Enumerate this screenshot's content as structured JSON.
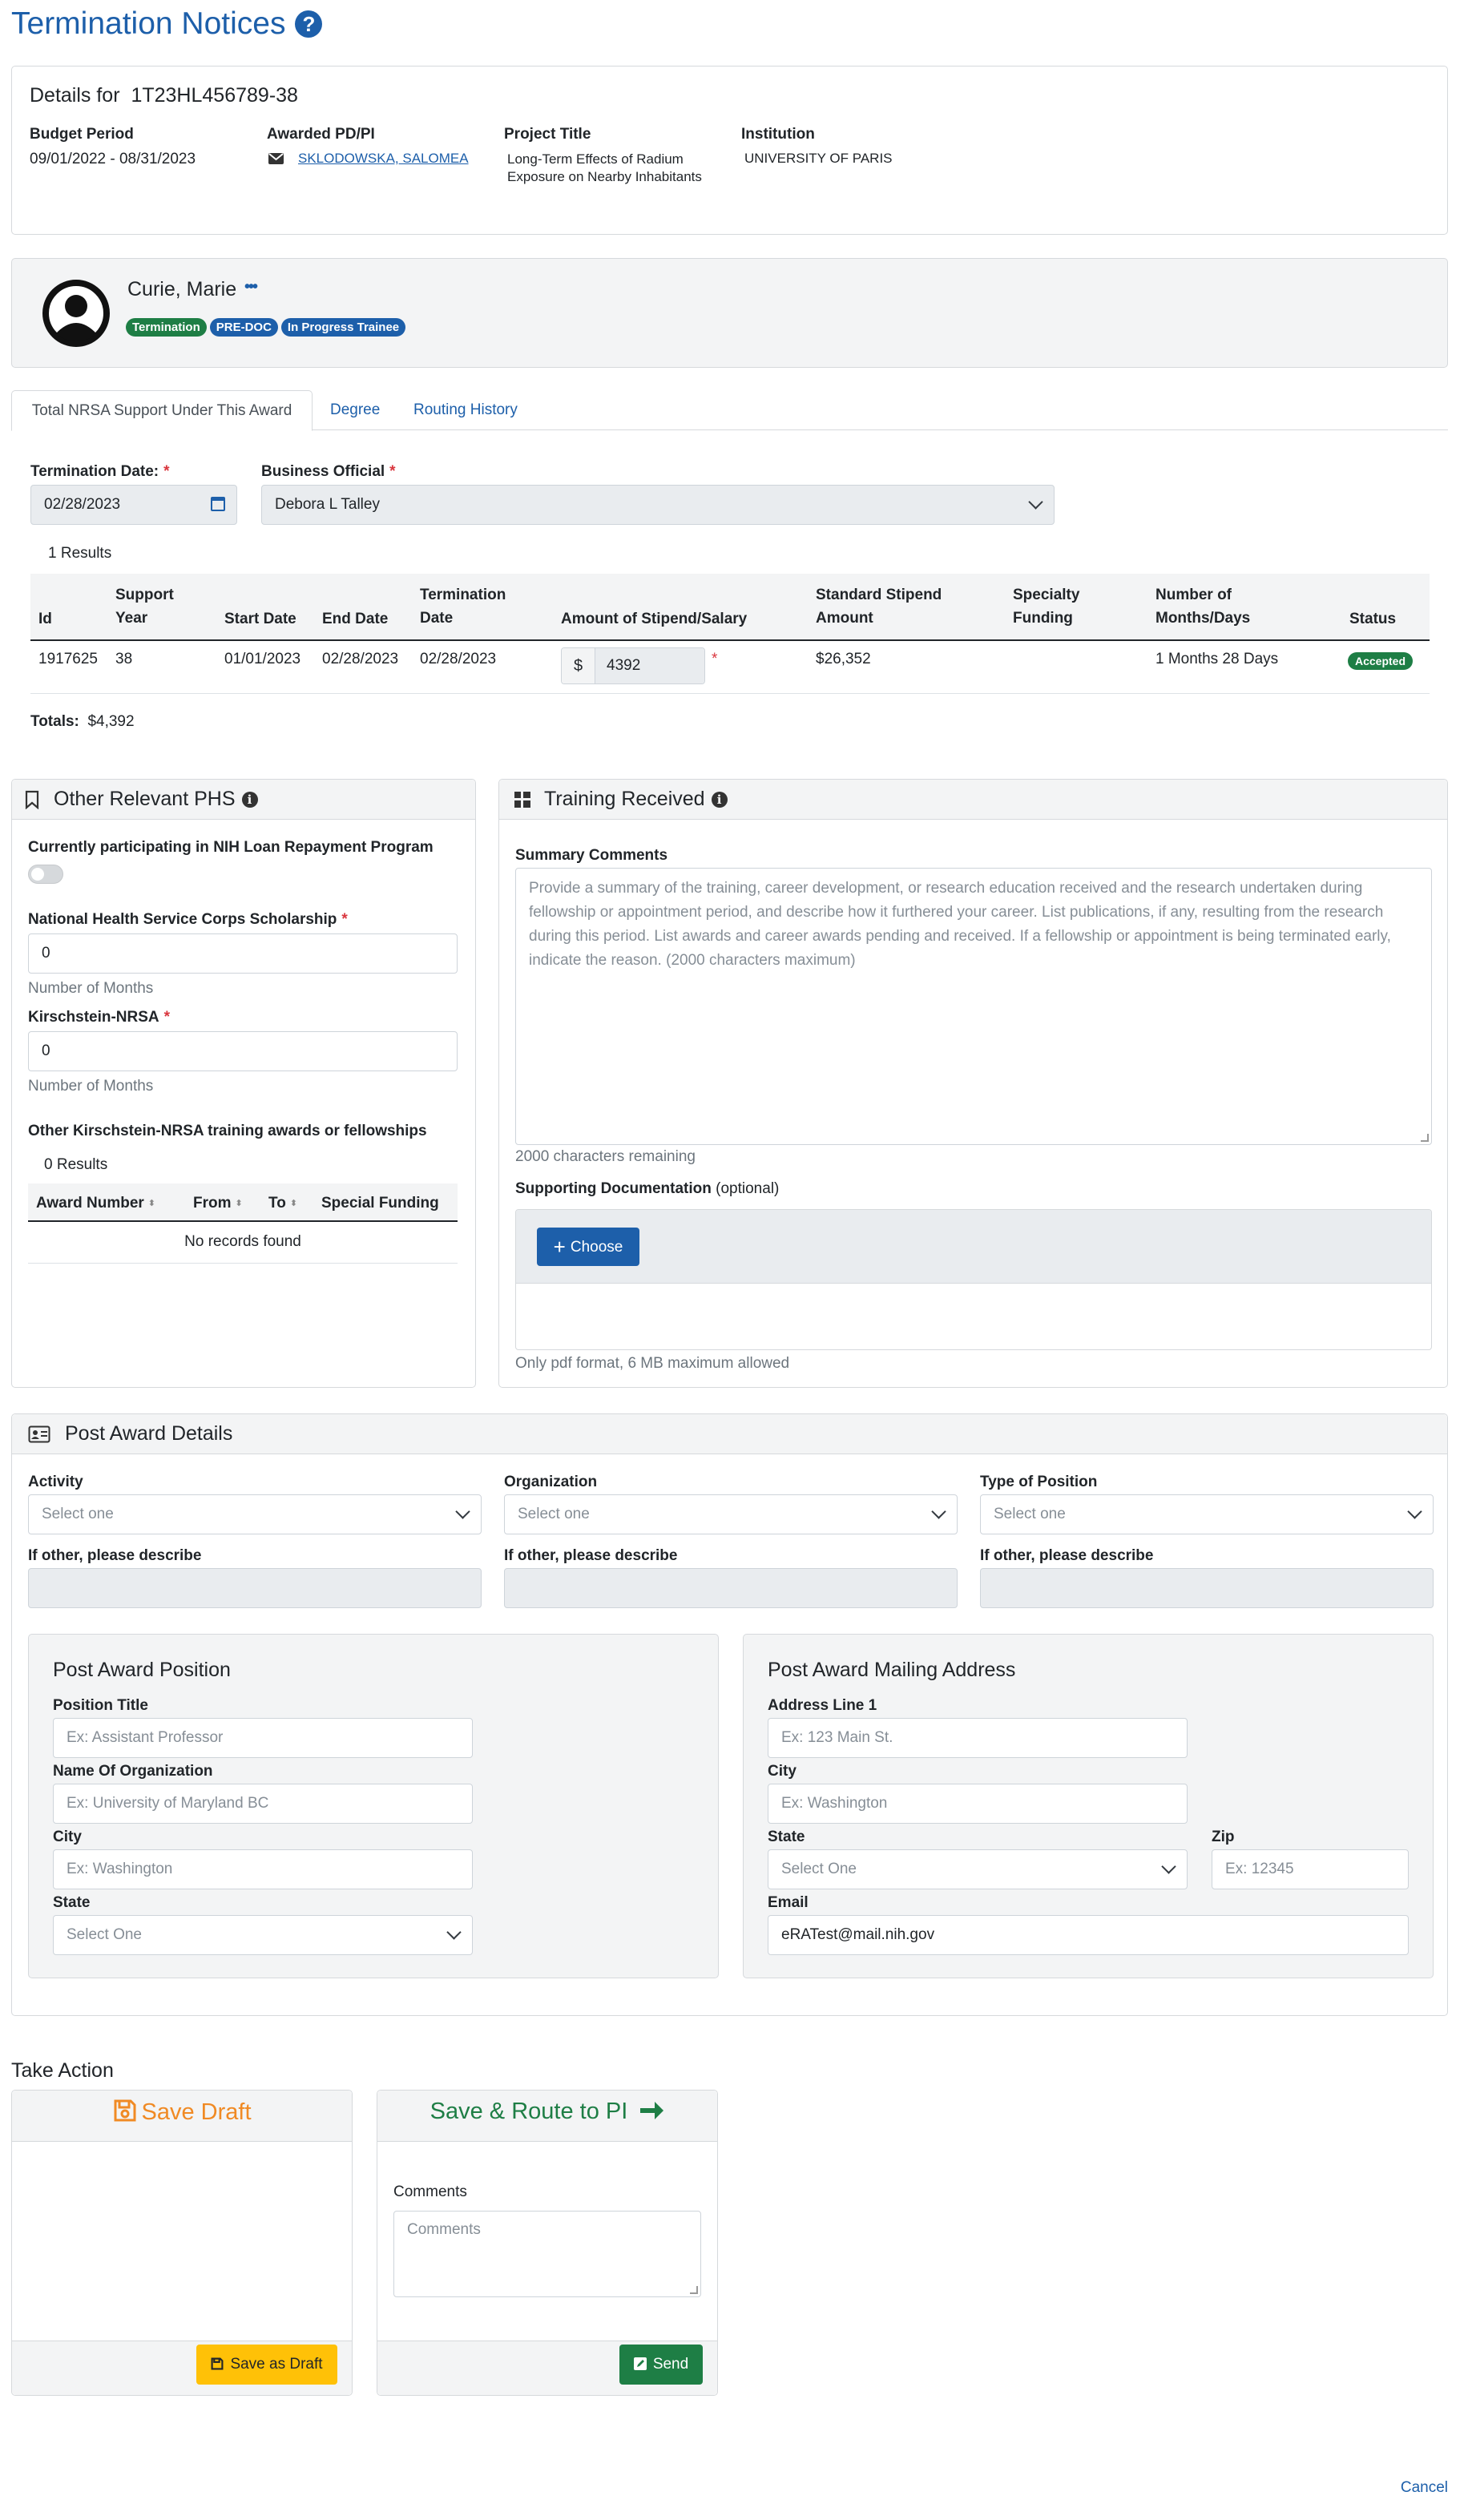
{
  "page": {
    "title": "Termination Notices"
  },
  "details": {
    "label": "Details for",
    "grant_number": "1T23HL456789-38",
    "budget_period_label": "Budget Period",
    "budget_period": "09/01/2022 - 08/31/2023",
    "pi_label": "Awarded PD/PI",
    "pi_name": "SKLODOWSKA, SALOMEA",
    "project_title_label": "Project Title",
    "project_title_line1": "Long-Term Effects of Radium",
    "project_title_line2": "Exposure on Nearby Inhabitants",
    "institution_label": "Institution",
    "institution": "UNIVERSITY OF PARIS"
  },
  "trainee": {
    "name": "Curie, Marie",
    "more": "•••",
    "badges": [
      "Termination",
      "PRE-DOC",
      "In Progress Trainee"
    ],
    "badge_colors": [
      "#1e7e45",
      "#1d5faa",
      "#1d5faa"
    ]
  },
  "tabs": [
    "Total NRSA Support Under This Award",
    "Degree",
    "Routing History"
  ],
  "termination": {
    "date_label": "Termination Date:",
    "date_value": "02/28/2023",
    "bo_label": "Business Official",
    "bo_value": "Debora L Talley",
    "results": "1 Results"
  },
  "support_table": {
    "headers": [
      "Id",
      "Support Year",
      "Start Date",
      "End Date",
      "Termination Date",
      "Amount of Stipend/Salary",
      "Standard Stipend Amount",
      "Specialty Funding",
      "Number of Months/Days",
      "Status"
    ],
    "row": {
      "id": "1917625",
      "year": "38",
      "start": "01/01/2023",
      "end": "02/28/2023",
      "term": "02/28/2023",
      "currency": "$",
      "amount": "4392",
      "standard": "$26,352",
      "specialty": "",
      "months": "1 Months 28 Days",
      "status": "Accepted"
    },
    "totals_label": "Totals:",
    "totals_value": "$4,392"
  },
  "phs": {
    "title": "Other Relevant PHS",
    "loan_label": "Currently participating in NIH Loan Repayment Program",
    "nhsc_label": "National Health Service Corps Scholarship",
    "nhsc_value": "0",
    "months_help": "Number of Months",
    "nrsa_label": "Kirschstein-NRSA",
    "nrsa_value": "0",
    "other_label": "Other Kirschstein-NRSA training awards or fellowships",
    "results": "0 Results",
    "headers": [
      "Award Number",
      "From",
      "To",
      "Special Funding"
    ],
    "empty": "No records found"
  },
  "training": {
    "title": "Training Received",
    "summary_label": "Summary Comments",
    "summary_placeholder": "Provide a summary of the training, career development, or research education received and the research undertaken during fellowship or appointment period, and describe how it furthered your career. List publications, if any, resulting from the research during this period. List awards and career awards pending and received. If a fellowship or appointment is being terminated early, indicate the reason. (2000 characters maximum)",
    "remaining": "2000 characters remaining",
    "doc_label": "Supporting Documentation",
    "doc_optional": "(optional)",
    "choose": "Choose",
    "doc_help": "Only pdf format, 6 MB maximum allowed"
  },
  "post_award": {
    "title": "Post Award Details",
    "activity_label": "Activity",
    "org_label": "Organization",
    "type_label": "Type of Position",
    "select_one": "Select one",
    "other_label": "If other, please describe",
    "position": {
      "title": "Post Award Position",
      "position_title_label": "Position Title",
      "position_title_ph": "Ex: Assistant Professor",
      "org_name_label": "Name Of Organization",
      "org_name_ph": "Ex: University of Maryland BC",
      "city_label": "City",
      "city_ph": "Ex: Washington",
      "state_label": "State",
      "state_value": "Select One"
    },
    "address": {
      "title": "Post Award Mailing Address",
      "line1_label": "Address Line 1",
      "line1_ph": "Ex: 123 Main St.",
      "city_label": "City",
      "city_ph": "Ex: Washington",
      "state_label": "State",
      "state_value": "Select One",
      "zip_label": "Zip",
      "zip_ph": "Ex: 12345",
      "email_label": "Email",
      "email_value": "eRATest@mail.nih.gov"
    }
  },
  "action": {
    "title": "Take Action",
    "save_draft_title": "Save Draft",
    "save_draft_button": "Save as Draft",
    "route_title": "Save & Route to PI",
    "comments_label": "Comments",
    "comments_ph": "Comments",
    "send_button": "Send",
    "cancel": "Cancel"
  },
  "colors": {
    "primary": "#1d5faa",
    "success": "#1e7e45",
    "warning": "#ffc107",
    "orange": "#f08a24",
    "required": "#d9363e"
  }
}
